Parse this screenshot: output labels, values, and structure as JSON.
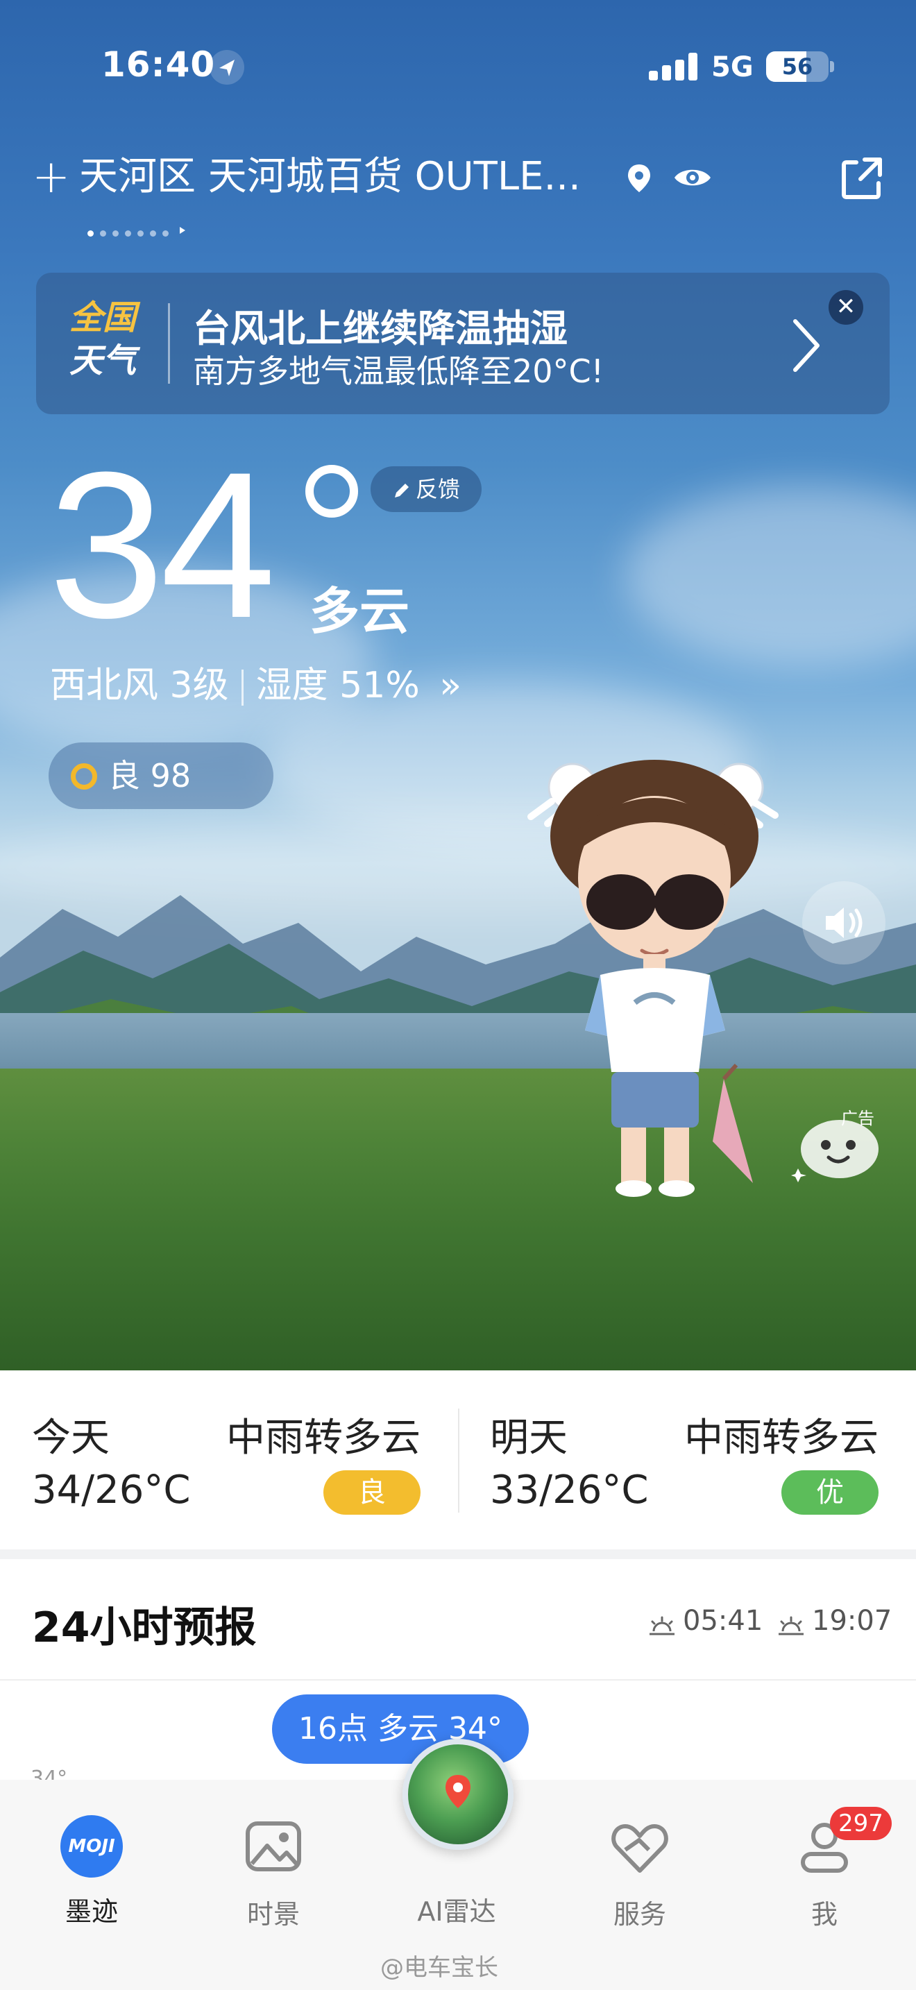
{
  "status_bar": {
    "time": "16:40",
    "network": "5G",
    "battery": "56"
  },
  "location": {
    "add_symbol": "+",
    "name": "天河区 天河城百货 OUTLE...",
    "page_count": 7,
    "active_page": 0
  },
  "banner": {
    "logo_line1": "全国",
    "logo_line2": "天气",
    "title": "台风北上继续降温抽湿",
    "subtitle": "南方多地气温最低降至20°C!",
    "close_symbol": "✕"
  },
  "current": {
    "temperature": "34",
    "feedback_label": "反馈",
    "condition": "多云",
    "wind": "西北风 3级",
    "humidity": "湿度 51%",
    "more_symbol": "»",
    "aqi": "良 98"
  },
  "ad": {
    "label": "广告"
  },
  "forecast_days": [
    {
      "label": "今天",
      "condition": "中雨转多云",
      "temp": "34/26°C",
      "aqi": "良",
      "aqi_color": "#f3bd2e"
    },
    {
      "label": "明天",
      "condition": "中雨转多云",
      "temp": "33/26°C",
      "aqi": "优",
      "aqi_color": "#5cbd5a"
    }
  ],
  "hourly": {
    "title": "24小时预报",
    "sunrise": "05:41",
    "sunset": "19:07",
    "bubble": "16点 多云 34°",
    "tick": "34°"
  },
  "tabs": [
    {
      "label": "墨迹",
      "icon": "moji-logo-icon",
      "logo_text": "MOJI",
      "active": true
    },
    {
      "label": "时景",
      "icon": "photo-icon",
      "active": false
    },
    {
      "label": "AI雷达",
      "icon": "radar-icon",
      "active": false
    },
    {
      "label": "服务",
      "icon": "heart-hands-icon",
      "active": false
    },
    {
      "label": "我",
      "icon": "user-icon",
      "active": false,
      "badge": "297"
    }
  ],
  "watermark": "@电车宝长",
  "colors": {
    "accent": "#2f7bf0",
    "badge_red": "#ec3a3a",
    "aqi_good": "#f3b82b"
  }
}
